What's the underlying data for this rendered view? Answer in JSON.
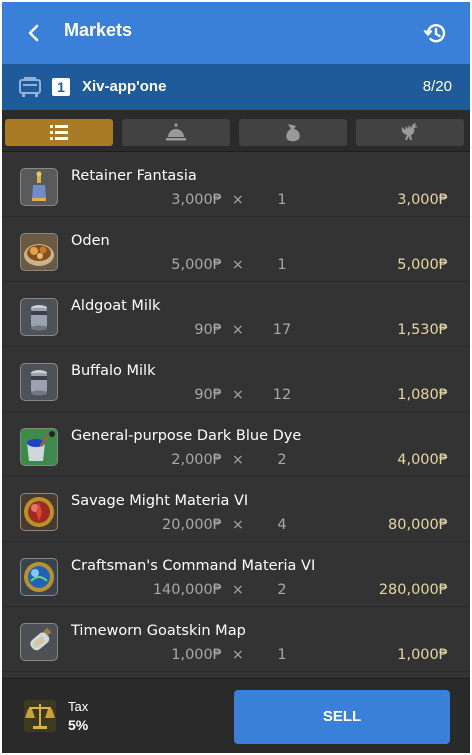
{
  "appbar": {
    "title": "Markets",
    "back_icon": "chevron-left-icon",
    "history_icon": "history-icon"
  },
  "retainer": {
    "icon": "retainer-bell-icon",
    "number": "1",
    "name": "Xiv-app'one",
    "count": "8/20"
  },
  "tabs": [
    {
      "name": "list",
      "icon": "list-icon",
      "active": true
    },
    {
      "name": "bell",
      "icon": "service-bell-icon",
      "active": false
    },
    {
      "name": "bag",
      "icon": "bag-icon",
      "active": false
    },
    {
      "name": "chocobo",
      "icon": "chocobo-icon",
      "active": false
    }
  ],
  "items": [
    {
      "name": "Retainer Fantasia",
      "price": "3,000₱",
      "times": "×",
      "qty": "1",
      "total": "3,000₱",
      "icon": "potion-bottle-icon"
    },
    {
      "name": "Oden",
      "price": "5,000₱",
      "times": "×",
      "qty": "1",
      "total": "5,000₱",
      "icon": "food-bowl-icon"
    },
    {
      "name": "Aldgoat Milk",
      "price": "90₱",
      "times": "×",
      "qty": "17",
      "total": "1,530₱",
      "icon": "milk-can-icon"
    },
    {
      "name": "Buffalo Milk",
      "price": "90₱",
      "times": "×",
      "qty": "12",
      "total": "1,080₱",
      "icon": "milk-can-icon"
    },
    {
      "name": "General-purpose Dark Blue Dye",
      "price": "2,000₱",
      "times": "×",
      "qty": "2",
      "total": "4,000₱",
      "icon": "dye-pot-icon"
    },
    {
      "name": "Savage Might Materia VI",
      "price": "20,000₱",
      "times": "×",
      "qty": "4",
      "total": "80,000₱",
      "icon": "red-materia-icon"
    },
    {
      "name": "Craftsman's Command Materia VI",
      "price": "140,000₱",
      "times": "×",
      "qty": "2",
      "total": "280,000₱",
      "icon": "blue-materia-icon"
    },
    {
      "name": "Timeworn Goatskin Map",
      "price": "1,000₱",
      "times": "×",
      "qty": "1",
      "total": "1,000₱",
      "icon": "map-bottle-icon"
    }
  ],
  "footer": {
    "tax_label": "Tax",
    "tax_value": "5%",
    "tax_icon": "scales-icon",
    "sell_label": "SELL"
  },
  "colors": {
    "primary": "#3a80d8",
    "retainer_bar": "#1f5b9a",
    "active_tab": "#a87b24",
    "total_text": "#e5d6a4"
  }
}
